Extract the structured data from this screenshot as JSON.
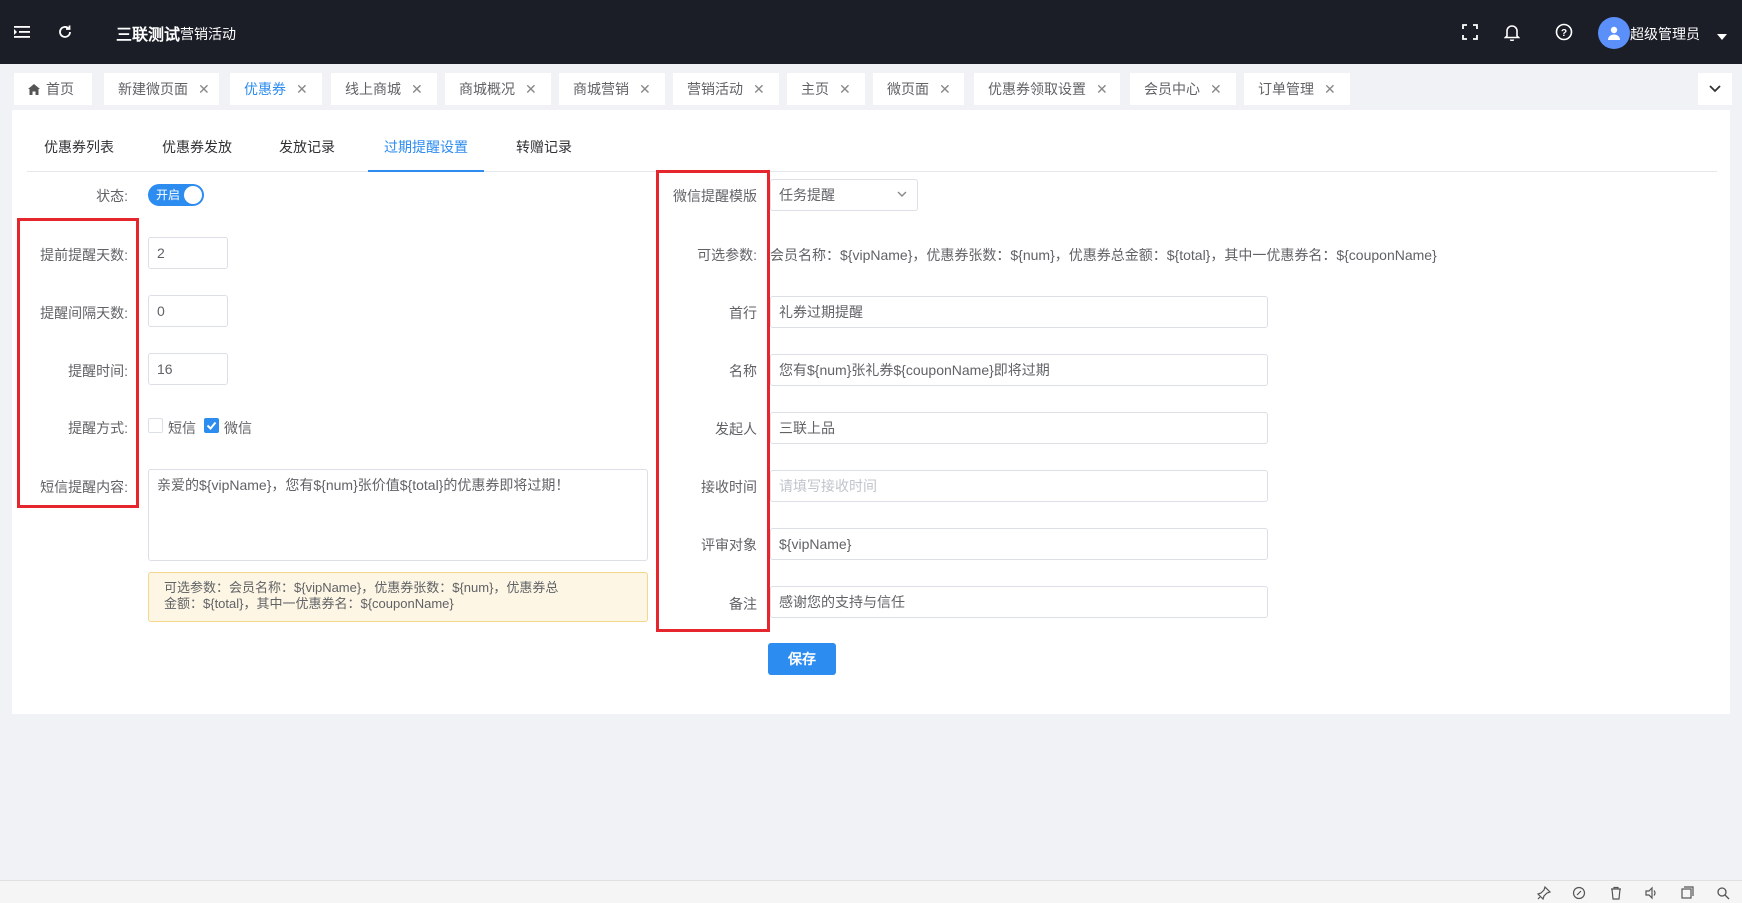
{
  "navbar": {
    "brand": "三联测试",
    "menu": "营销活动",
    "user": "超级管理员"
  },
  "tags": [
    {
      "label": "首页",
      "closable": false,
      "active": false,
      "icon": "home-icon"
    },
    {
      "label": "新建微页面",
      "closable": true,
      "active": false
    },
    {
      "label": "优惠券",
      "closable": true,
      "active": true
    },
    {
      "label": "线上商城",
      "closable": true,
      "active": false
    },
    {
      "label": "商城概况",
      "closable": true,
      "active": false
    },
    {
      "label": "商城营销",
      "closable": true,
      "active": false
    },
    {
      "label": "营销活动",
      "closable": true,
      "active": false
    },
    {
      "label": "主页",
      "closable": true,
      "active": false
    },
    {
      "label": "微页面",
      "closable": true,
      "active": false
    },
    {
      "label": "优惠券领取设置",
      "closable": true,
      "active": false
    },
    {
      "label": "会员中心",
      "closable": true,
      "active": false
    },
    {
      "label": "订单管理",
      "closable": true,
      "active": false
    }
  ],
  "subtabs": [
    {
      "label": "优惠券列表",
      "active": false
    },
    {
      "label": "优惠券发放",
      "active": false
    },
    {
      "label": "发放记录",
      "active": false
    },
    {
      "label": "过期提醒设置",
      "active": true
    },
    {
      "label": "转赠记录",
      "active": false
    }
  ],
  "left_form": {
    "status_label": "状态:",
    "status_switch_text": "开启",
    "status_on": true,
    "advance_days_label": "提前提醒天数:",
    "advance_days_value": "2",
    "interval_days_label": "提醒间隔天数:",
    "interval_days_value": "0",
    "remind_time_label": "提醒时间:",
    "remind_time_value": "16",
    "method_label": "提醒方式:",
    "method_sms_label": "短信",
    "method_sms_checked": false,
    "method_wechat_label": "微信",
    "method_wechat_checked": true,
    "sms_content_label": "短信提醒内容:",
    "sms_content_value": "亲爱的${vipName}，您有${num}张价值${total}的优惠券即将过期！",
    "tip_line1": "可选参数：会员名称：${vipName}，优惠券张数：${num}，优惠券总",
    "tip_line2": "金额：${total}，其中一优惠券名：${couponName}"
  },
  "right_form": {
    "template_label": "微信提醒模版",
    "template_value": "任务提醒",
    "params_label": "可选参数:",
    "params_value": "会员名称：${vipName}，优惠券张数：${num}，优惠券总金额：${total}，其中一优惠券名：${couponName}",
    "first_label": "首行",
    "first_value": "礼券过期提醒",
    "name_label": "名称",
    "name_value": "您有${num}张礼券${couponName}即将过期",
    "initiator_label": "发起人",
    "initiator_value": "三联上品",
    "receive_time_label": "接收时间",
    "receive_time_placeholder": "请填写接收时间",
    "review_label": "评审对象",
    "review_value": "${vipName}",
    "remark_label": "备注",
    "remark_value": "感谢您的支持与信任",
    "save_label": "保存"
  },
  "colors": {
    "primary": "#2d8cf0",
    "navbar_bg": "#1b1e27",
    "highlight_box": "#e5272d",
    "tip_bg": "#fdf6e4"
  }
}
